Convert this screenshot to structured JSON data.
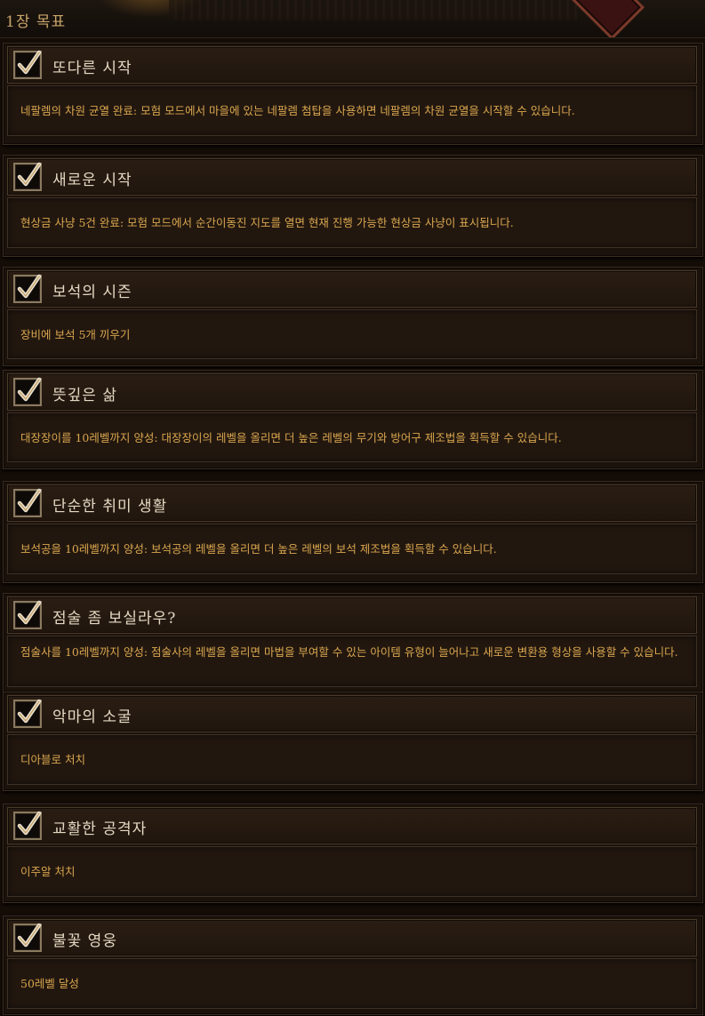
{
  "header": {
    "title": "1장 목표"
  },
  "achievements": [
    {
      "title": "또다른 시작",
      "description": "네팔렘의 차원 균열 완료: 모험 모드에서 마을에 있는 네팔렘 첨탑을 사용하면 네팔렘의 차원 균열을 시작할 수 있습니다.",
      "completed": true
    },
    {
      "title": "새로운 시작",
      "description": "현상금 사냥 5건 완료: 모험 모드에서 순간이동진 지도를 열면 현재 진행 가능한 현상금 사냥이 표시됩니다.",
      "completed": true
    },
    {
      "title": "보석의 시즌",
      "description": "장비에 보석 5개 끼우기",
      "completed": true
    },
    {
      "title": "뜻깊은 삶",
      "description": "대장장이를 10레벨까지 양성: 대장장이의 레벨을 올리면 더 높은 레벨의 무기와 방어구 제조법을 획득할 수 있습니다.",
      "completed": true
    },
    {
      "title": "단순한 취미 생활",
      "description": "보석공을 10레벨까지 양성: 보석공의 레벨을 올리면 더 높은 레벨의 보석 제조법을 획득할 수 있습니다.",
      "completed": true
    },
    {
      "title": "점술 좀 보실라우?",
      "description": "점술사를 10레벨까지 양성: 점술사의 레벨을 올리면 마법을 부여할 수 있는 아이템 유형이 늘어나고 새로운 변환용 형상을 사용할 수 있습니다.",
      "completed": true
    },
    {
      "title": "악마의 소굴",
      "description": "디아블로 처치",
      "completed": true
    },
    {
      "title": "교활한 공격자",
      "description": "이주알 처치",
      "completed": true
    },
    {
      "title": "불꽃 영웅",
      "description": "50레벨 달성",
      "completed": true
    }
  ],
  "colors": {
    "title": "#e4d9c2",
    "description": "#d9a64e",
    "header": "#c9a46b"
  },
  "icons": {
    "checkmark": "checkmark-icon"
  }
}
